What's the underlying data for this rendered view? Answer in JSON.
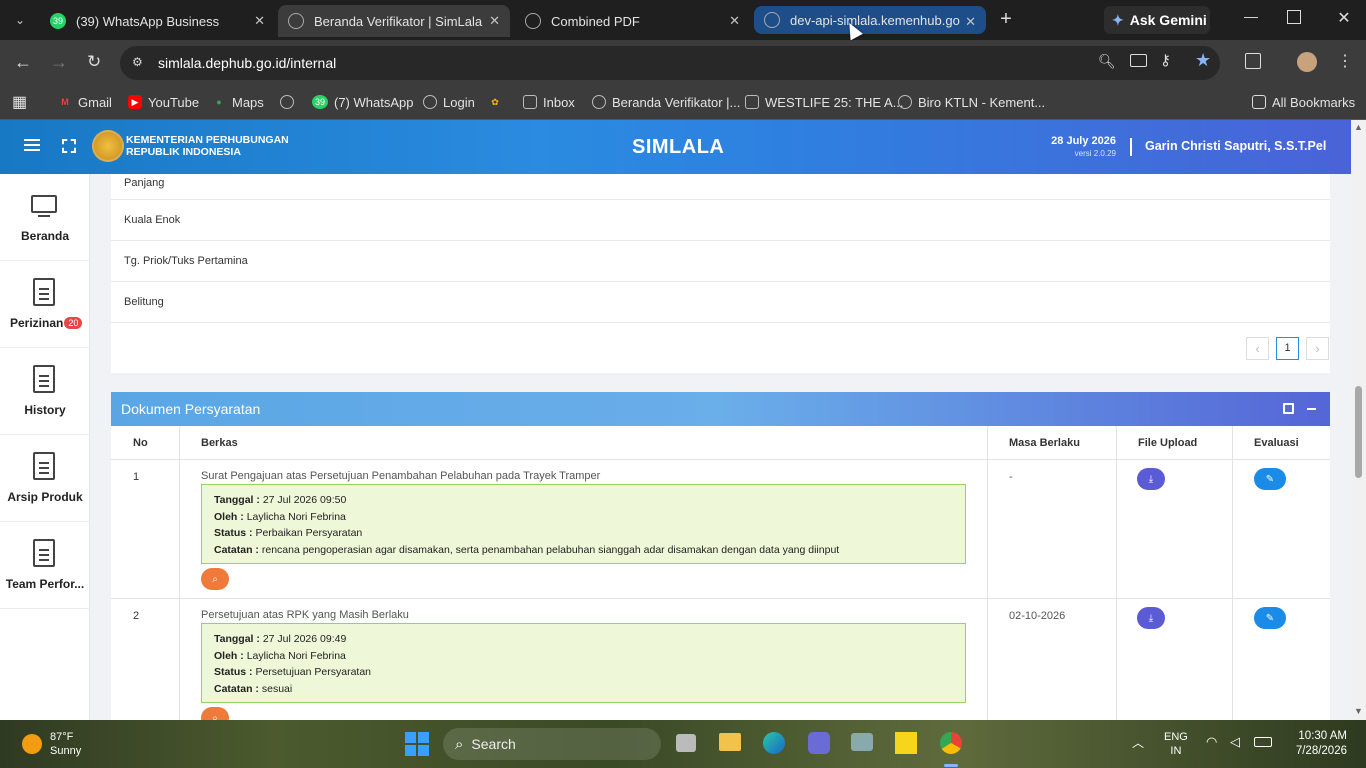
{
  "browser": {
    "tabs": [
      {
        "title": "(39) WhatsApp Business",
        "badge": "39"
      },
      {
        "title": "Beranda Verifikator | SimLala"
      },
      {
        "title": "Combined PDF"
      },
      {
        "title": "dev-api-simlala.kemenhub.go.id"
      }
    ],
    "ask_gemini": "Ask Gemini",
    "url": "simlala.dephub.go.id/internal",
    "bookmarks": [
      "Gmail",
      "YouTube",
      "Maps",
      "(7) WhatsApp",
      "Login",
      "Inbox",
      "Beranda Verifikator |...",
      "WESTLIFE 25: THE A...",
      "Biro KTLN - Kement..."
    ],
    "bookmark_badge": "39",
    "all_bookmarks": "All Bookmarks"
  },
  "header": {
    "org_line1": "KEMENTERIAN PERHUBUNGAN",
    "org_line2": "REPUBLIK INDONESIA",
    "app_title": "SIMLALA",
    "date": "28 July 2026",
    "version": "versi 2.0.29",
    "user": "Garin Christi Saputri, S.S.T.Pel"
  },
  "sidebar": {
    "items": [
      {
        "label": "Beranda"
      },
      {
        "label": "Perizinan",
        "badge": "20"
      },
      {
        "label": "History"
      },
      {
        "label": "Arsip Produk"
      },
      {
        "label": "Team Perfor..."
      }
    ]
  },
  "ports": {
    "rows": [
      "Panjang",
      "Kuala Enok",
      "Tg. Priok/Tuks Pertamina",
      "Belitung"
    ],
    "pagination": {
      "prev": "‹",
      "current": "1",
      "next": "›"
    }
  },
  "docs": {
    "title": "Dokumen Persyaratan",
    "columns": [
      "No",
      "Berkas",
      "Masa Berlaku",
      "File Upload",
      "Evaluasi"
    ],
    "labels": {
      "tanggal": "Tanggal :",
      "oleh": "Oleh :",
      "status": "Status :",
      "catatan": "Catatan :"
    },
    "rows": [
      {
        "no": "1",
        "berkas": "Surat Pengajuan atas Persetujuan Penambahan Pelabuhan pada Trayek Tramper",
        "tanggal": "27 Jul 2026 09:50",
        "oleh": "Laylicha Nori Febrina",
        "status": "Perbaikan Persyaratan",
        "catatan": "rencana pengoperasian agar disamakan, serta penambahan pelabuhan sianggah adar disamakan dengan data yang diinput",
        "masa_berlaku": "-"
      },
      {
        "no": "2",
        "berkas": "Persetujuan atas RPK yang Masih Berlaku",
        "tanggal": "27 Jul 2026 09:49",
        "oleh": "Laylicha Nori Febrina",
        "status": "Persetujuan Persyaratan",
        "catatan": "sesuai",
        "masa_berlaku": "02-10-2026"
      }
    ]
  },
  "taskbar": {
    "weather_temp": "87°F",
    "weather_desc": "Sunny",
    "search_placeholder": "Search",
    "lang1": "ENG",
    "lang2": "IN",
    "time": "10:30 AM",
    "date": "7/28/2026"
  },
  "colors": {
    "header_blue": "#2a8be0",
    "panel_blue": "#6aaeea",
    "upload_purple": "#5b5bd6",
    "eval_blue": "#1a8be6",
    "search_orange": "#f07a3a",
    "badge_red": "#e84545",
    "note_green_bg": "#eef8d8"
  }
}
